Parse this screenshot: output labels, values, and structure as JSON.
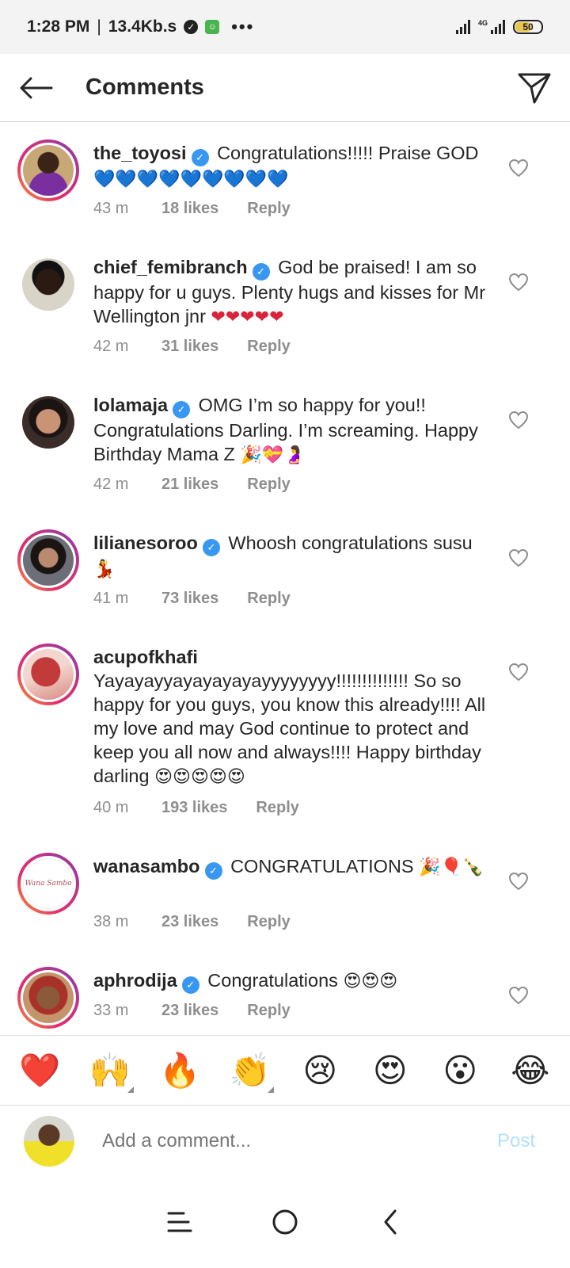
{
  "status_bar": {
    "time": "1:28 PM",
    "separator": "|",
    "speed": "13.4Kb.s",
    "more": "•••",
    "network": "4G",
    "battery": "50"
  },
  "header": {
    "title": "Comments"
  },
  "comments": [
    {
      "username": "the_toyosi",
      "verified": true,
      "text": "Congratulations!!!!! Praise GOD",
      "emojis": "💙💙💙💙💙💙💙💙💙",
      "time": "43 m",
      "likes": "18 likes",
      "reply": "Reply"
    },
    {
      "username": "chief_femibranch",
      "verified": true,
      "text": "God be praised! I am so happy for u guys. Plenty hugs and kisses for Mr Wellington jnr",
      "emojis": "❤❤❤❤❤",
      "time": "42 m",
      "likes": "31 likes",
      "reply": "Reply"
    },
    {
      "username": "lolamaja",
      "verified": true,
      "text": "OMG I’m so happy for you!! Congratulations Darling. I’m screaming. Happy Birthday Mama Z",
      "emojis": "🎉💝🤰",
      "time": "42 m",
      "likes": "21 likes",
      "reply": "Reply"
    },
    {
      "username": "lilianesoroo",
      "verified": true,
      "text": "Whoosh congratulations susu",
      "emojis": "💃",
      "time": "41 m",
      "likes": "73 likes",
      "reply": "Reply"
    },
    {
      "username": "acupofkhafi",
      "verified": false,
      "text": "Yayayayyayayayayayyyyyyyy!!!!!!!!!!!!!! So so happy for you guys, you know this already!!!! All my love and may God continue to protect and keep you all now and always!!!! Happy birthday darling",
      "emojis": "😍😍😍😍😍",
      "time": "40 m",
      "likes": "193 likes",
      "reply": "Reply"
    },
    {
      "username": "wanasambo",
      "verified": true,
      "text": "CONGRATULATIONS",
      "emojis": "🎉🎈🍾",
      "time": "38 m",
      "likes": "23 likes",
      "reply": "Reply",
      "avatar_text": "Wana Sambo"
    },
    {
      "username": "aphrodija",
      "verified": true,
      "text": "Congratulations",
      "emojis": "😍😍😍",
      "time": "33 m",
      "likes": "23 likes",
      "reply": "Reply"
    }
  ],
  "quick_emojis": [
    "❤️",
    "🙌",
    "🔥",
    "👏",
    "😢",
    "😍",
    "😮",
    "😂"
  ],
  "composer": {
    "placeholder": "Add a comment...",
    "post_label": "Post"
  },
  "colors": {
    "verified": "#3897f0",
    "muted": "#8e8e8e",
    "post_disabled": "#b2dffc",
    "divider": "#dbdbdb"
  }
}
